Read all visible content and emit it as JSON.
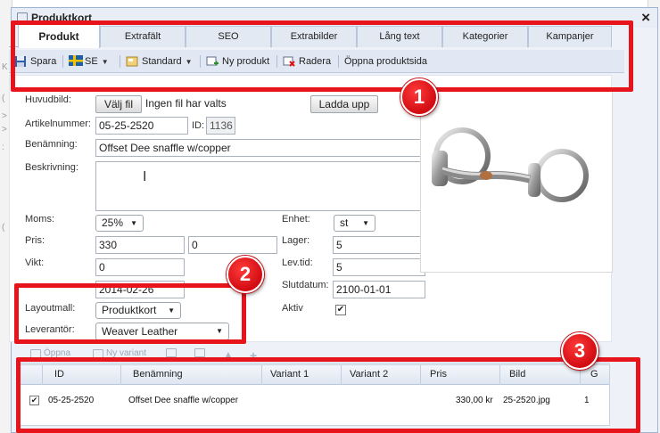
{
  "window": {
    "title": "Produktkort"
  },
  "tabs": [
    {
      "label": "Produkt",
      "active": true
    },
    {
      "label": "Extrafält"
    },
    {
      "label": "SEO"
    },
    {
      "label": "Extrabilder"
    },
    {
      "label": "Lång text"
    },
    {
      "label": "Kategorier"
    },
    {
      "label": "Kampanjer"
    }
  ],
  "toolbar": {
    "save": "Spara",
    "language": "SE",
    "standard": "Standard",
    "new_product": "Ny produkt",
    "delete": "Radera",
    "open_page": "Öppna produktsida"
  },
  "form": {
    "main_image_label": "Huvudbild:",
    "choose_file": "Välj fil",
    "no_file": "Ingen fil har valts",
    "upload": "Ladda upp",
    "article_label": "Artikelnummer:",
    "article_value": "05-25-2520",
    "id_label": "ID:",
    "id_value": "1136",
    "name_label": "Benämning:",
    "name_value": "Offset Dee snaffle w/copper",
    "desc_label": "Beskrivning:",
    "desc_value": "",
    "vat_label": "Moms:",
    "vat_value": "25%",
    "unit_label": "Enhet:",
    "unit_value": "st",
    "price_label": "Pris:",
    "price_value": "330",
    "price_value2": "0",
    "stock_label": "Lager:",
    "stock_value": "5",
    "weight_label": "Vikt:",
    "weight_value": "0",
    "leadtime_label": "Lev.tid:",
    "leadtime_value": "5",
    "startdate_value": "2014-02-26",
    "enddate_label": "Slutdatum:",
    "enddate_value": "2100-01-01",
    "layout_label": "Layoutmall:",
    "layout_value": "Produktkort",
    "active_label": "Aktiv",
    "active_checked": true,
    "supplier_label": "Leverantör:",
    "supplier_value": "Weaver Leather"
  },
  "variants_toolbar": {
    "open": "Öppna",
    "new_variant": "Ny variant"
  },
  "variants": {
    "columns": [
      "ID",
      "Benämning",
      "Variant 1",
      "Variant 2",
      "Pris",
      "Bild",
      "G"
    ],
    "rows": [
      {
        "checked": true,
        "id": "05-25-2520",
        "name": "Offset Dee snaffle w/copper",
        "variant1": "",
        "variant2": "",
        "price": "330,00 kr",
        "image": "25-2520.jpg",
        "g": "1"
      }
    ]
  },
  "callouts": [
    "1",
    "2",
    "3"
  ],
  "colors": {
    "callout": "#e8141c",
    "window_bg": "#eef2f8",
    "tab_border": "#b7c6dc"
  }
}
